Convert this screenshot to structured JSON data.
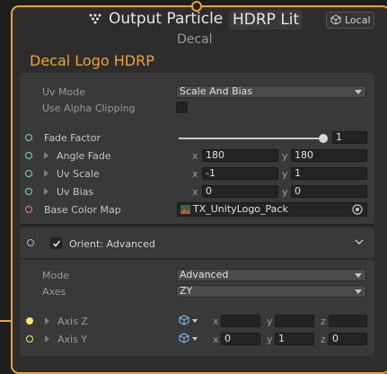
{
  "header": {
    "title": "Output Particle",
    "title_badge": "HDRP Lit",
    "subtitle": "Decal",
    "space_button": "Local",
    "node_name": "Decal Logo HDRP"
  },
  "settings": {
    "uv_mode": {
      "label": "Uv Mode",
      "value": "Scale And Bias"
    },
    "alpha_clipping": {
      "label": "Use Alpha Clipping",
      "checked": false
    }
  },
  "properties": {
    "fade_factor": {
      "label": "Fade Factor",
      "value": "1",
      "slider_fraction": 1.0
    },
    "angle_fade": {
      "label": "Angle Fade",
      "x_label": "x",
      "x": "180",
      "y_label": "y",
      "y": "180"
    },
    "uv_scale": {
      "label": "Uv Scale",
      "x_label": "x",
      "x": "-1",
      "y_label": "y",
      "y": "1"
    },
    "uv_bias": {
      "label": "Uv Bias",
      "x_label": "x",
      "x": "0",
      "y_label": "y",
      "y": "0"
    },
    "base_color_map": {
      "label": "Base Color Map",
      "value": "TX_UnityLogo_Pack"
    }
  },
  "orient_block": {
    "title": "Orient: Advanced",
    "enabled": true,
    "mode": {
      "label": "Mode",
      "value": "Advanced"
    },
    "axes": {
      "label": "Axes",
      "value": "ZY"
    },
    "axis_z": {
      "label": "Axis Z",
      "x_label": "x",
      "x": "",
      "y_label": "y",
      "y": "",
      "z_label": "z",
      "z": ""
    },
    "axis_y": {
      "label": "Axis Y",
      "x_label": "x",
      "x": "0",
      "y_label": "y",
      "y": "1",
      "z_label": "z",
      "z": "0"
    }
  },
  "colors": {
    "accent": "#f1a233",
    "port_float": "#7ed6c3",
    "port_vector": "#f5e36b",
    "port_texture": "#f08080",
    "port_block": "#b9a4f5"
  },
  "icons": [
    "particle-output-icon",
    "local-space-icon",
    "chevron-down-icon",
    "texture-icon",
    "object-picker-icon",
    "vector-space-icon"
  ]
}
